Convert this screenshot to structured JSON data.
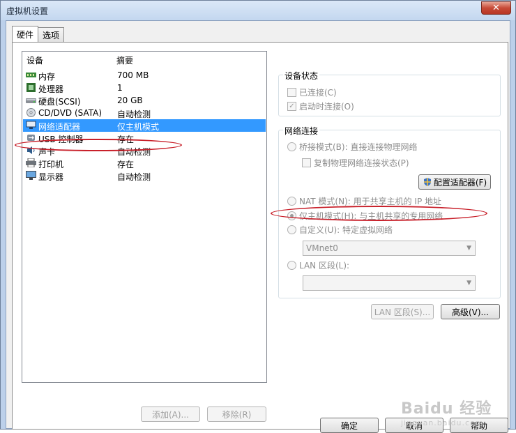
{
  "window": {
    "title": "虚拟机设置"
  },
  "tabs": [
    {
      "label": "硬件"
    },
    {
      "label": "选项"
    }
  ],
  "devices": {
    "col_device": "设备",
    "col_summary": "摘要",
    "rows": [
      {
        "name": "内存",
        "summary": "700 MB",
        "icon": "memory-icon"
      },
      {
        "name": "处理器",
        "summary": "1",
        "icon": "cpu-icon"
      },
      {
        "name": "硬盘(SCSI)",
        "summary": "20 GB",
        "icon": "hard-disk-icon"
      },
      {
        "name": "CD/DVD (SATA)",
        "summary": "自动检测",
        "icon": "cd-dvd-icon"
      },
      {
        "name": "网络适配器",
        "summary": "仅主机模式",
        "icon": "network-adapter-icon",
        "selected": true
      },
      {
        "name": "USB 控制器",
        "summary": "存在",
        "icon": "usb-icon"
      },
      {
        "name": "声卡",
        "summary": "自动检测",
        "icon": "sound-card-icon"
      },
      {
        "name": "打印机",
        "summary": "存在",
        "icon": "printer-icon"
      },
      {
        "name": "显示器",
        "summary": "自动检测",
        "icon": "display-icon"
      }
    ],
    "add_label": "添加(A)...",
    "remove_label": "移除(R)"
  },
  "device_status": {
    "title": "设备状态",
    "connected": "已连接(C)",
    "connect_on_start": "启动时连接(O)"
  },
  "network": {
    "title": "网络连接",
    "bridged": "桥接模式(B): 直接连接物理网络",
    "replicate": "复制物理网络连接状态(P)",
    "configure_adapters": "配置适配器(F)",
    "nat": "NAT 模式(N): 用于共享主机的 IP 地址",
    "host_only": "仅主机模式(H): 与主机共享的专用网络",
    "custom": "自定义(U): 特定虚拟网络",
    "custom_value": "VMnet0",
    "lan_segment": "LAN 区段(L):",
    "lan_segment_value": ""
  },
  "panel_buttons": {
    "lan_segments": "LAN 区段(S)...",
    "advanced": "高级(V)..."
  },
  "footer": {
    "ok": "确定",
    "cancel": "取消",
    "help": "帮助"
  },
  "watermark": {
    "text": "Baidu 经验",
    "sub": "jingyan.baidu.com"
  }
}
